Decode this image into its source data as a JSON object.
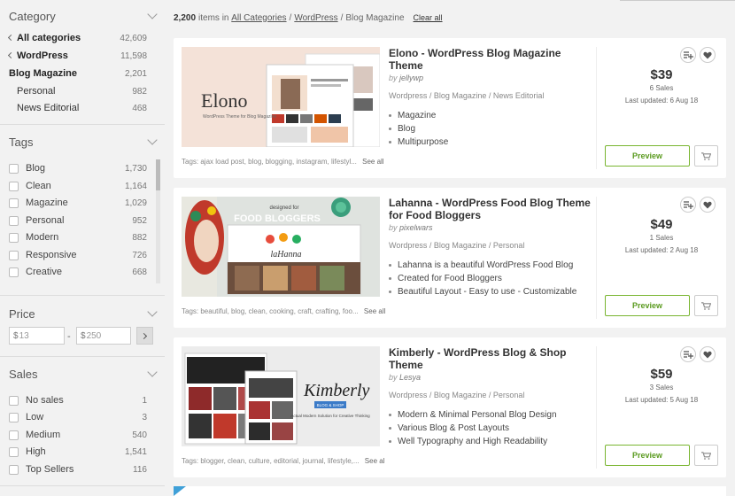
{
  "sidebar": {
    "category": {
      "title": "Category",
      "items": [
        {
          "label": "All categories",
          "count": "42,609"
        },
        {
          "label": "WordPress",
          "count": "11,598"
        },
        {
          "label": "Blog Magazine",
          "count": "2,201"
        },
        {
          "label": "Personal",
          "count": "982"
        },
        {
          "label": "News Editorial",
          "count": "468"
        }
      ]
    },
    "tags": {
      "title": "Tags",
      "items": [
        {
          "label": "Blog",
          "count": "1,730"
        },
        {
          "label": "Clean",
          "count": "1,164"
        },
        {
          "label": "Magazine",
          "count": "1,029"
        },
        {
          "label": "Personal",
          "count": "952"
        },
        {
          "label": "Modern",
          "count": "882"
        },
        {
          "label": "Responsive",
          "count": "726"
        },
        {
          "label": "Creative",
          "count": "668"
        }
      ]
    },
    "price": {
      "title": "Price",
      "min_placeholder": "13",
      "max_placeholder": "250",
      "currency": "$",
      "dash": "-"
    },
    "sales": {
      "title": "Sales",
      "items": [
        {
          "label": "No sales",
          "count": "1"
        },
        {
          "label": "Low",
          "count": "3"
        },
        {
          "label": "Medium",
          "count": "540"
        },
        {
          "label": "High",
          "count": "1,541"
        },
        {
          "label": "Top Sellers",
          "count": "116"
        }
      ]
    }
  },
  "results": {
    "count": "2,200",
    "items_in": "items in",
    "breadcrumb": [
      "All Categories",
      "WordPress",
      "Blog Magazine"
    ],
    "separator": "/",
    "clear_all": "Clear all"
  },
  "products": [
    {
      "title": "Elono - WordPress Blog Magazine Theme",
      "by": "by",
      "author": "jellywp",
      "category": "Wordpress / Blog Magazine / News Editorial",
      "bullets": [
        "Magazine",
        "Blog",
        "Multipurpose"
      ],
      "price": "$39",
      "sales": "6 Sales",
      "updated": "Last updated: 6 Aug 18",
      "tags": "Tags: ajax load post, blog, blogging, instagram, lifestyl...",
      "see_all": "See all tags",
      "preview": "Preview",
      "thumb_logo": "Elono",
      "thumb_sub": "WordPress Theme for Blog Magazine"
    },
    {
      "title": "Lahanna - WordPress Food Blog Theme for Food Bloggers",
      "by": "by",
      "author": "pixelwars",
      "category": "Wordpress / Blog Magazine / Personal",
      "bullets": [
        "Lahanna is a beautiful WordPress Food Blog",
        "Created for Food Bloggers",
        "Beautiful Layout - Easy to use - Customizable"
      ],
      "price": "$49",
      "sales": "1 Sales",
      "updated": "Last updated: 2 Aug 18",
      "tags": "Tags: beautiful, blog, clean, cooking, craft, crafting, foo...",
      "see_all": "See all tags",
      "preview": "Preview",
      "thumb_pre": "designed for",
      "thumb_head": "FOOD BLOGGERS",
      "thumb_logo": "laHanna"
    },
    {
      "title": "Kimberly - WordPress Blog & Shop Theme",
      "by": "by",
      "author": "Lesya",
      "category": "Wordpress / Blog Magazine / Personal",
      "bullets": [
        "Modern & Minimal Personal Blog Design",
        "Various Blog & Post Layouts",
        "Well Typography and High Readability"
      ],
      "price": "$59",
      "sales": "3 Sales",
      "updated": "Last updated: 5 Aug 18",
      "tags": "Tags: blogger, clean, culture, editorial, journal, lifestyle,...",
      "see_all": "See all tags",
      "preview": "Preview",
      "thumb_logo": "Kimberly",
      "thumb_badge": "BLOG & SHOP",
      "thumb_sub": "Actual Modern Solution for Creative Thinking"
    }
  ],
  "colors": {
    "accent_green": "#79b530",
    "background": "#f2f2f2"
  }
}
